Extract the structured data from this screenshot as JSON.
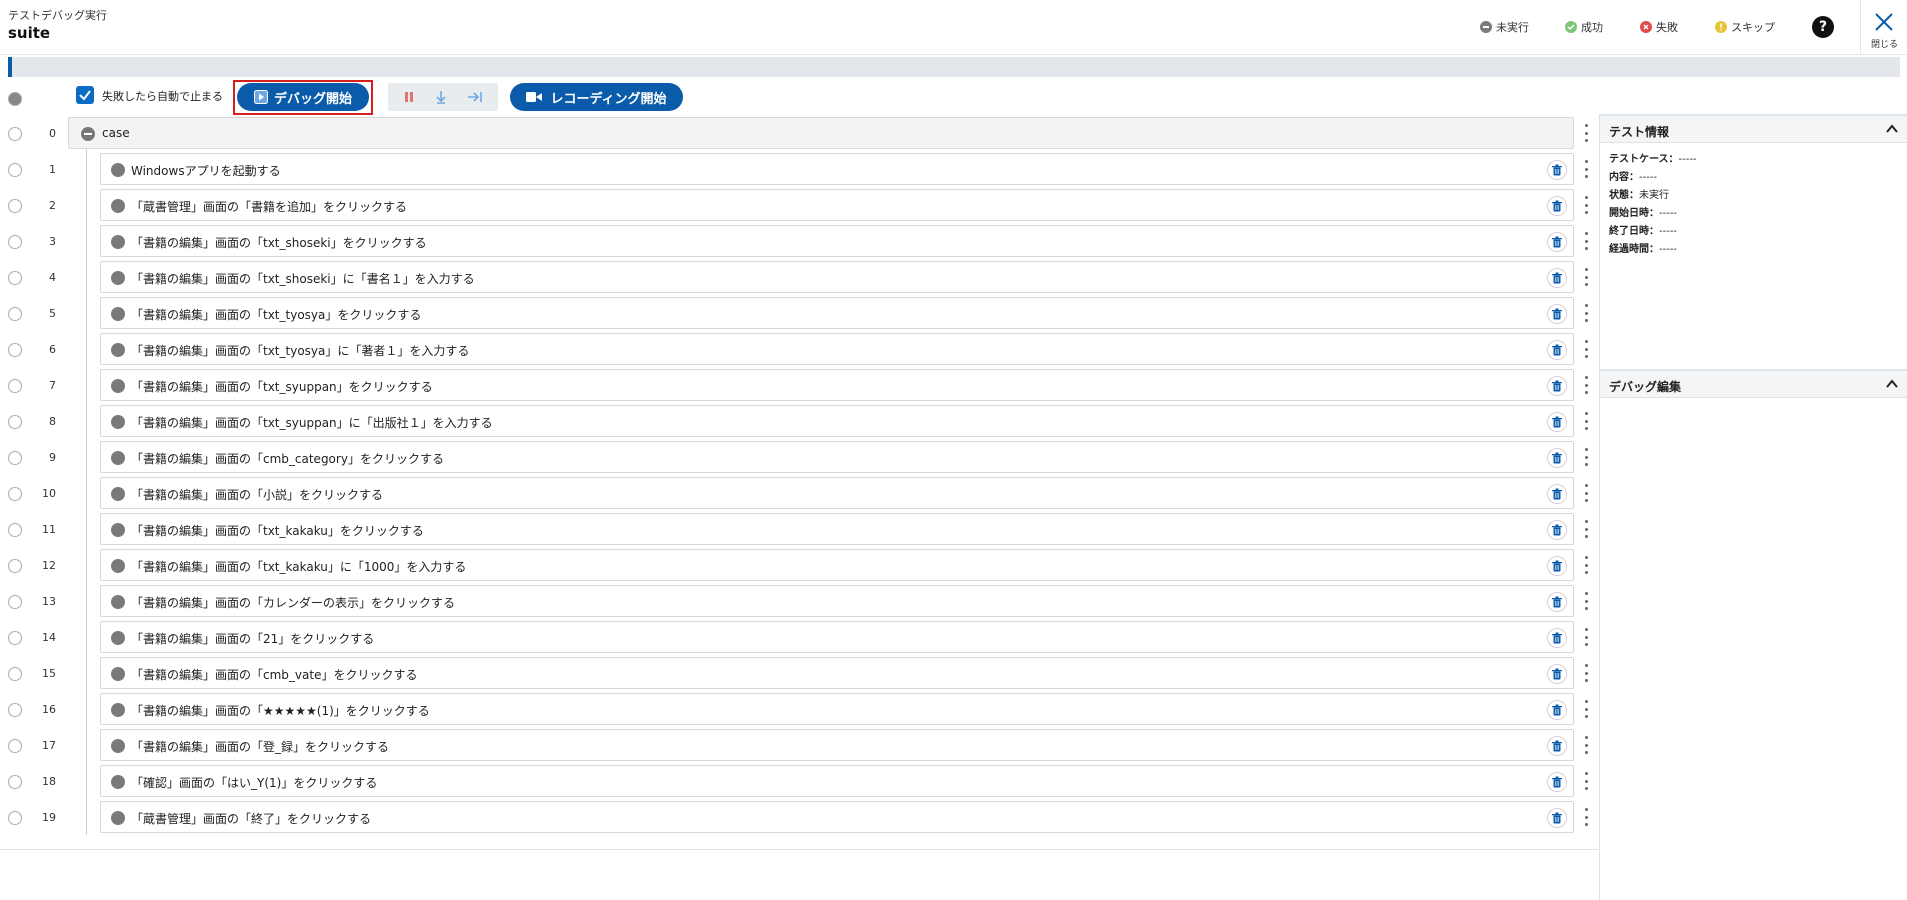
{
  "header": {
    "subtitle": "テストデバッグ実行",
    "title": "suite",
    "legend": [
      {
        "label": "未実行",
        "color": "#7a7a7a"
      },
      {
        "label": "成功",
        "color": "#7ec57a"
      },
      {
        "label": "失敗",
        "color": "#e04b4b"
      },
      {
        "label": "スキップ",
        "color": "#e8c435"
      }
    ],
    "help_label": "?",
    "close_label": "閉じる"
  },
  "toolbar": {
    "auto_stop_label": "失敗したら自動で止まる",
    "auto_stop_checked": true,
    "debug_start_label": "デバッグ開始",
    "recording_start_label": "レコーディング開始"
  },
  "case": {
    "index": "0",
    "label": "case"
  },
  "steps": [
    {
      "index": "1",
      "label": "Windowsアプリを起動する"
    },
    {
      "index": "2",
      "label": "「蔵書管理」画面の「書籍を追加」をクリックする"
    },
    {
      "index": "3",
      "label": "「書籍の編集」画面の「txt_shoseki」をクリックする"
    },
    {
      "index": "4",
      "label": "「書籍の編集」画面の「txt_shoseki」に「書名１」を入力する"
    },
    {
      "index": "5",
      "label": "「書籍の編集」画面の「txt_tyosya」をクリックする"
    },
    {
      "index": "6",
      "label": "「書籍の編集」画面の「txt_tyosya」に「著者１」を入力する"
    },
    {
      "index": "7",
      "label": "「書籍の編集」画面の「txt_syuppan」をクリックする"
    },
    {
      "index": "8",
      "label": "「書籍の編集」画面の「txt_syuppan」に「出版社１」を入力する"
    },
    {
      "index": "9",
      "label": "「書籍の編集」画面の「cmb_category」をクリックする"
    },
    {
      "index": "10",
      "label": "「書籍の編集」画面の「小説」をクリックする"
    },
    {
      "index": "11",
      "label": "「書籍の編集」画面の「txt_kakaku」をクリックする"
    },
    {
      "index": "12",
      "label": "「書籍の編集」画面の「txt_kakaku」に「1000」を入力する"
    },
    {
      "index": "13",
      "label": "「書籍の編集」画面の「カレンダーの表示」をクリックする"
    },
    {
      "index": "14",
      "label": "「書籍の編集」画面の「21」をクリックする"
    },
    {
      "index": "15",
      "label": "「書籍の編集」画面の「cmb_vate」をクリックする"
    },
    {
      "index": "16",
      "label": "「書籍の編集」画面の「★★★★★(1)」をクリックする"
    },
    {
      "index": "17",
      "label": "「書籍の編集」画面の「登_録」をクリックする"
    },
    {
      "index": "18",
      "label": "「確認」画面の「はい_Y(1)」をクリックする"
    },
    {
      "index": "19",
      "label": "「蔵書管理」画面の「終了」をクリックする"
    }
  ],
  "test_info": {
    "heading": "テスト情報",
    "fields": [
      {
        "label": "テストケース：",
        "value": "-----"
      },
      {
        "label": "内容：",
        "value": "-----"
      },
      {
        "label": "状態：",
        "value": "未実行"
      },
      {
        "label": "開始日時：",
        "value": "-----"
      },
      {
        "label": "終了日時：",
        "value": "-----"
      },
      {
        "label": "経過時間：",
        "value": "-----"
      }
    ]
  },
  "debug_edit": {
    "heading": "デバッグ編集"
  },
  "colors": {
    "accent": "#0a5cab",
    "highlight": "#d62020",
    "pause": "#e57373"
  }
}
